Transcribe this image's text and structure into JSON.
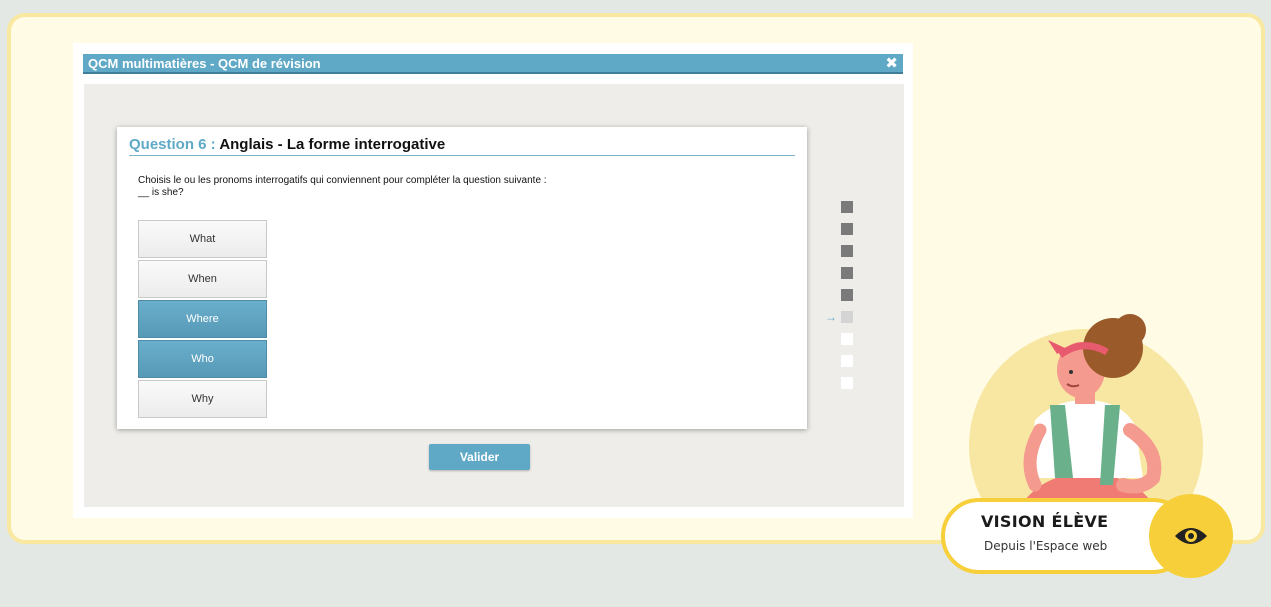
{
  "window": {
    "title": "QCM multimatières - QCM de révision",
    "close_glyph": "✖"
  },
  "question": {
    "number_label": "Question 6 :",
    "title": "Anglais - La forme interrogative",
    "instruction": "Choisis le ou les pronoms interrogatifs qui conviennent pour compléter la question suivante :",
    "sentence": "__ is she?"
  },
  "choices": [
    {
      "label": "What",
      "selected": false
    },
    {
      "label": "When",
      "selected": false
    },
    {
      "label": "Where",
      "selected": true
    },
    {
      "label": "Who",
      "selected": true
    },
    {
      "label": "Why",
      "selected": false
    }
  ],
  "validate_label": "Valider",
  "progress": {
    "current_arrow": "→",
    "states": [
      "done",
      "done",
      "done",
      "done",
      "done",
      "current",
      "todo",
      "todo",
      "todo"
    ]
  },
  "badge": {
    "title": "VISION ÉLÈVE",
    "subtitle": "Depuis l'Espace web",
    "icon": "eye-icon"
  },
  "colors": {
    "accent": "#5fa9c7",
    "badge_yellow": "#f6cf3a",
    "card_bg": "#fffbe4"
  }
}
